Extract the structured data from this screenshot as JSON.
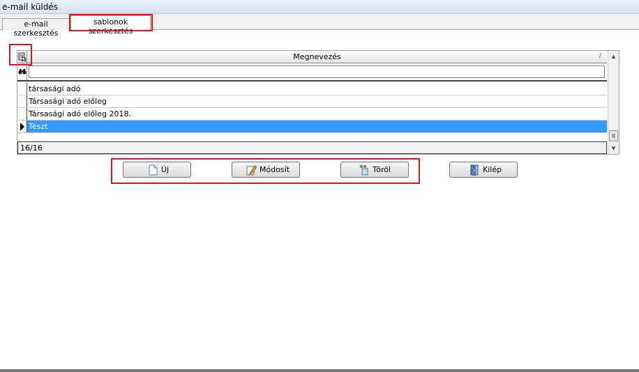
{
  "window": {
    "title": "e-mail küldés"
  },
  "tabs": [
    {
      "label": "e-mail szerkesztés"
    },
    {
      "label": "sablonok szerkesztés"
    }
  ],
  "grid": {
    "column_header": "Megnevezés",
    "sort_mark": "/",
    "filter_value": "",
    "rows": [
      {
        "name": "társasági adó"
      },
      {
        "name": "Társasági adó előleg"
      },
      {
        "name": "Társasági adó előleg 2018."
      },
      {
        "name": "Teszt"
      }
    ],
    "record_count": "16/16"
  },
  "buttons": {
    "new": "Új",
    "edit": "Módosít",
    "delete": "Töröl",
    "exit": "Kilép"
  },
  "colors": {
    "selection": "#3399ff",
    "highlight_box": "#e3151a"
  },
  "icons": [
    "grid-settings-icon",
    "binoculars-icon",
    "row-pointer-icon",
    "new-document-icon",
    "edit-pencil-icon",
    "delete-icon",
    "exit-door-icon"
  ]
}
